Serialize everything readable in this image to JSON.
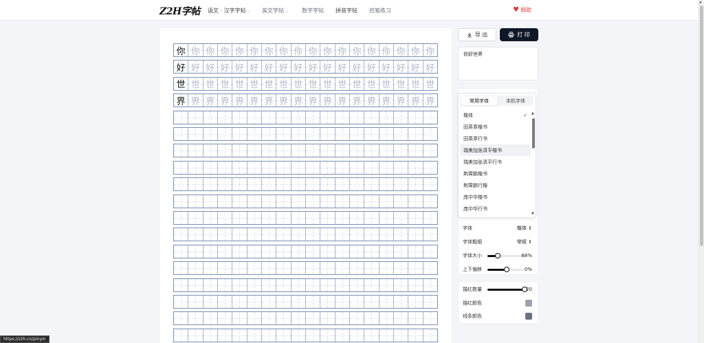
{
  "header": {
    "logo": "Z2H字帖",
    "nav": [
      {
        "label": "语文 · 汉字字帖",
        "chevron": true
      },
      {
        "label": "英文字帖",
        "chevron": true
      },
      {
        "label": "数字字帖",
        "chevron": false
      },
      {
        "label": "拼音字帖",
        "chevron": false
      },
      {
        "label": "控笔练习",
        "chevron": false
      }
    ],
    "donate": "捐助"
  },
  "toolbar": {
    "export_label": "导 出",
    "print_label": "打 印"
  },
  "text_input": {
    "value": "你好世界"
  },
  "worksheet": {
    "characters": [
      "你",
      "好",
      "世",
      "界"
    ],
    "columns": 18,
    "empty_rows": 14
  },
  "font_dropdown": {
    "tabs": [
      "常用字体",
      "本机字体"
    ],
    "active_tab": 0,
    "items": [
      "楷体",
      "田英章楷书",
      "田英章行书",
      "瑞美加张清平楷书",
      "瑞美加张清平行书",
      "荆霄鹏楷书",
      "荆霄鹏行楷",
      "庞中华楷书",
      "庞中华行书"
    ],
    "selected": "楷体"
  },
  "settings": {
    "font": {
      "label": "字体",
      "value": "楷体"
    },
    "weight": {
      "label": "字体粗细",
      "value": "常规"
    },
    "size": {
      "label": "字体大小",
      "value": "68%",
      "fraction": 0.27
    },
    "offset": {
      "label": "上下偏移",
      "value": "0%",
      "fraction": 0.52
    },
    "trace_count": {
      "label": "描红数量",
      "value": "20",
      "fraction": 1.0
    },
    "trace_color": {
      "label": "描红颜色",
      "color": "#9ca3af"
    },
    "line_color": {
      "label": "线条颜色",
      "color": "#6b7280"
    }
  },
  "status_url": "https://z2h.cn/pinyin"
}
